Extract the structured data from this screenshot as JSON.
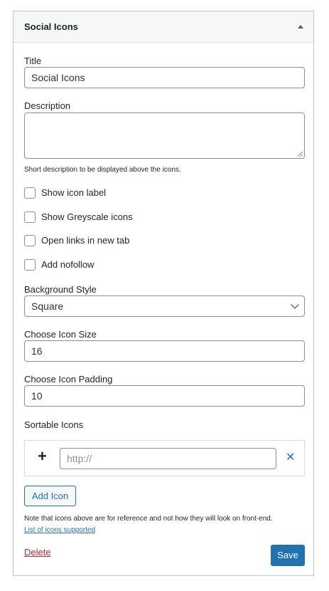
{
  "widget": {
    "title": "Social Icons",
    "fields": {
      "title_label": "Title",
      "title_value": "Social Icons",
      "description_label": "Description",
      "description_value": "",
      "description_help": "Short description to be displayed above the icons."
    },
    "checkboxes": [
      {
        "label": "Show icon label",
        "checked": false
      },
      {
        "label": "Show Greyscale icons",
        "checked": false
      },
      {
        "label": "Open links in new tab",
        "checked": false
      },
      {
        "label": "Add nofollow",
        "checked": false
      }
    ],
    "background_style": {
      "label": "Background Style",
      "value": "Square"
    },
    "icon_size": {
      "label": "Choose Icon Size",
      "value": "16"
    },
    "icon_padding": {
      "label": "Choose Icon Padding",
      "value": "10"
    },
    "sortable": {
      "label": "Sortable Icons",
      "plus": "+",
      "url_placeholder": "http://",
      "remove": "✕"
    },
    "add_icon_label": "Add Icon",
    "note": "Note that icons above are for reference and not how they will look on front-end.",
    "list_link": "List of icons supported",
    "delete_label": "Delete",
    "save_label": "Save"
  },
  "colors": {
    "accent": "#2271b1",
    "delete": "#b32d2e",
    "border": "#8c8f94"
  }
}
